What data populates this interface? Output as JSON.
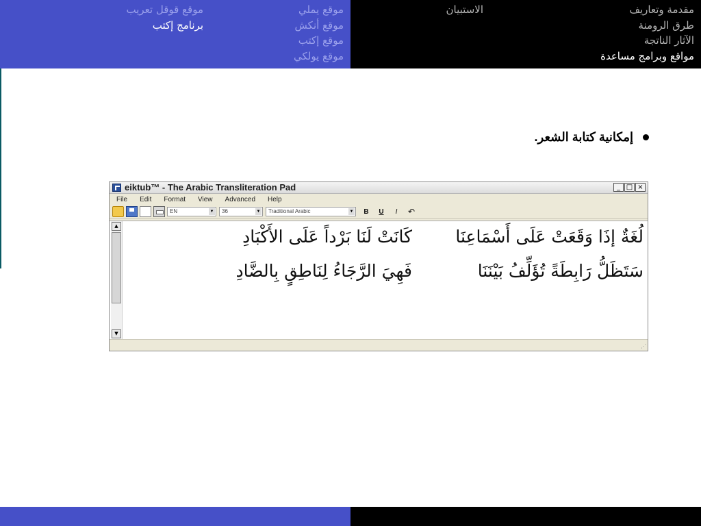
{
  "colors": {
    "accent_blue": "#4650c8",
    "header_black": "#000000",
    "active_text": "#ffffff",
    "muted_text": "#b3b3b3",
    "link_text": "#9aa0ec"
  },
  "nav_main": [
    {
      "label": "مقدمة وتعاريف",
      "active": false
    },
    {
      "label": "طرق الرومنة",
      "active": false
    },
    {
      "label": "الآثار الناتجة",
      "active": false
    },
    {
      "label": "مواقع وبرامج مساعدة",
      "active": true
    }
  ],
  "nav_survey": {
    "label": "الاستبيان"
  },
  "nav_sites": [
    {
      "label": "موقع يملي"
    },
    {
      "label": "موقع أنكش"
    },
    {
      "label": "موقع إكتب"
    },
    {
      "label": "موقع يولكي"
    }
  ],
  "nav_tools": [
    {
      "label": "موقع قوقل تعريب",
      "active": false
    },
    {
      "label": "برنامج إكتب",
      "active": true
    }
  ],
  "bullet": {
    "text": "إمكانية كتابة الشعر."
  },
  "app_window": {
    "title": "eiktub™ - The Arabic Transliteration Pad",
    "window_buttons": [
      "_",
      "□",
      "×"
    ],
    "menu": [
      "File",
      "Edit",
      "Format",
      "View",
      "Advanced",
      "Help"
    ],
    "toolbar": {
      "icons": [
        "open-folder-icon",
        "save-icon",
        "new-document-icon",
        "print-icon"
      ],
      "language": "EN",
      "font_size": "36",
      "font_name": "Traditional Arabic",
      "bold": "B",
      "underline": "U",
      "italic": "I",
      "direction": "↶"
    },
    "poem": {
      "line1": {
        "first": "لُغَةٌ إذَا وَقَعَتْ عَلَى أَسْمَاعِنَا",
        "second": "كَانَتْ لَنَا بَرْداً عَلَى الأَكْبَادِ"
      },
      "line2": {
        "first": "سَتَظَلُّ رَابِطَةً تُؤَلِّفُ بَيْنَنَا",
        "second": "فَهِيَ الرَّجَاءُ لِنَاطِقٍ بِالضَّادِ"
      }
    },
    "scrollbar": {
      "up": "▲",
      "down": "▼"
    }
  }
}
